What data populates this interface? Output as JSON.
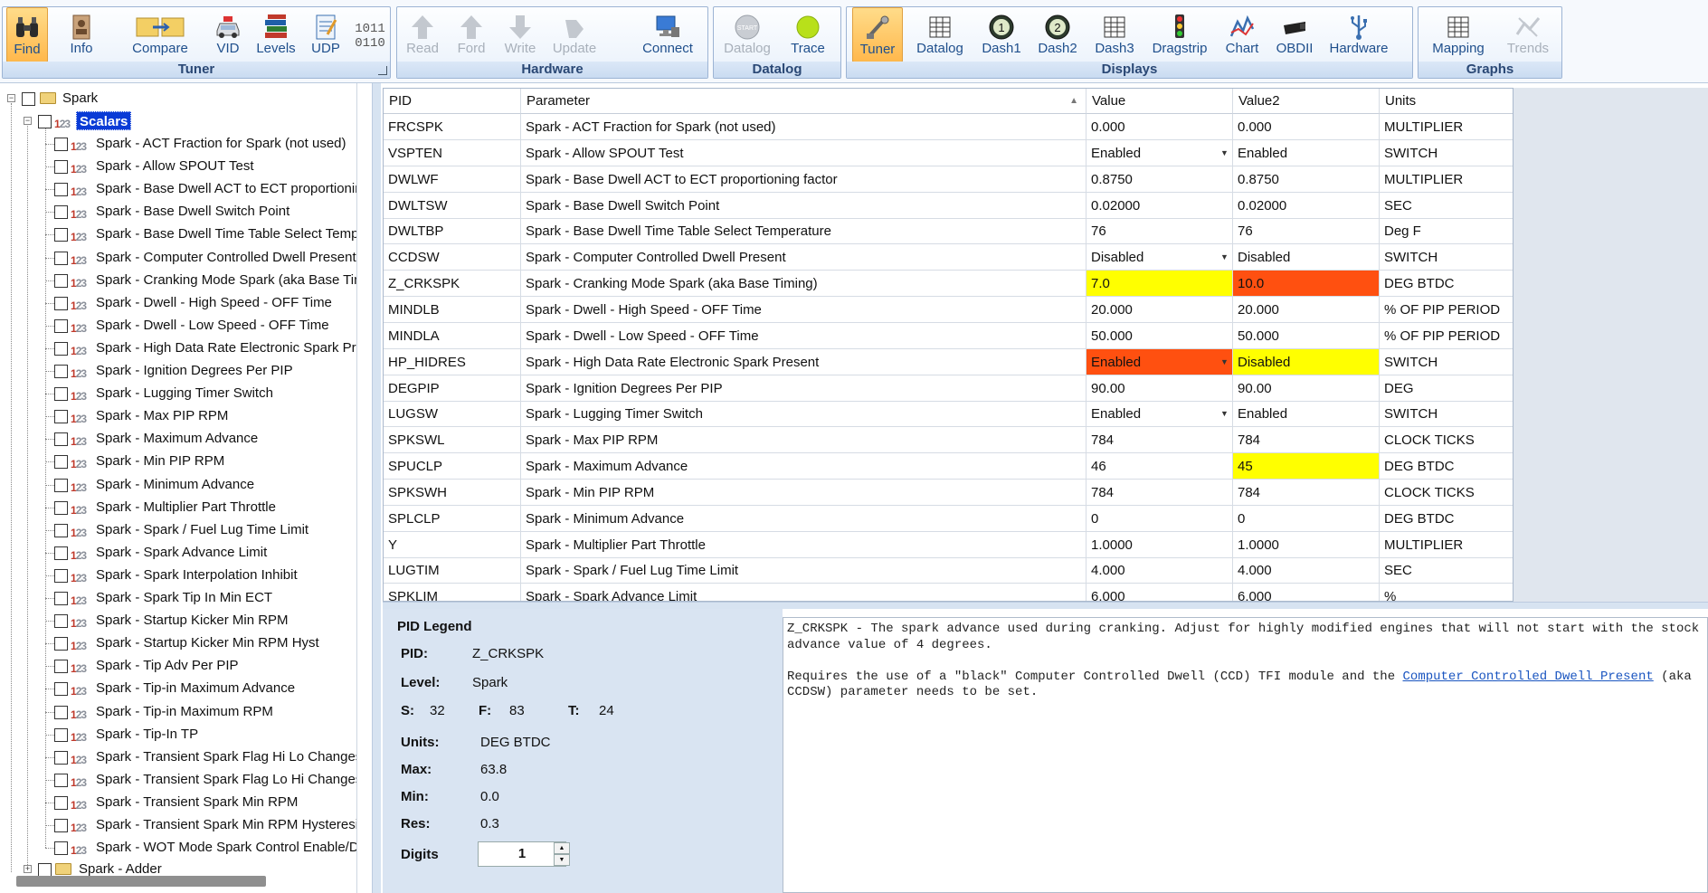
{
  "ribbon": {
    "groups": [
      {
        "title": "Tuner",
        "buttons": [
          {
            "label": "Find",
            "icon": "binoculars-icon",
            "state": "active"
          },
          {
            "label": "Info",
            "icon": "info-card-icon",
            "state": "normal"
          },
          {
            "label": "Compare",
            "icon": "compare-folders-icon",
            "state": "normal"
          },
          {
            "label": "VID",
            "icon": "vehicle-icon",
            "state": "normal"
          },
          {
            "label": "Levels",
            "icon": "books-icon",
            "state": "normal"
          },
          {
            "label": "UDP",
            "icon": "notepad-icon",
            "state": "normal"
          },
          {
            "label": "",
            "icon": "binary-icon",
            "state": "normal"
          }
        ]
      },
      {
        "title": "Hardware",
        "buttons": [
          {
            "label": "Read",
            "icon": "arrow-up-icon",
            "state": "disabled"
          },
          {
            "label": "Ford",
            "icon": "arrow-up-icon",
            "state": "disabled"
          },
          {
            "label": "Write",
            "icon": "arrow-down-icon",
            "state": "disabled"
          },
          {
            "label": "Update",
            "icon": "update-icon",
            "state": "disabled"
          },
          {
            "label": "Connect",
            "icon": "connect-computer-icon",
            "state": "normal"
          }
        ]
      },
      {
        "title": "Datalog",
        "buttons": [
          {
            "label": "Datalog",
            "icon": "start-button-icon",
            "state": "disabled"
          },
          {
            "label": "Trace",
            "icon": "green-dot-icon",
            "state": "normal"
          }
        ]
      },
      {
        "title": "Displays",
        "buttons": [
          {
            "label": "Tuner",
            "icon": "tuner-icon",
            "state": "active"
          },
          {
            "label": "Datalog",
            "icon": "grid-icon",
            "state": "normal"
          },
          {
            "label": "Dash1",
            "icon": "gauge-1-icon",
            "state": "normal"
          },
          {
            "label": "Dash2",
            "icon": "gauge-2-icon",
            "state": "normal"
          },
          {
            "label": "Dash3",
            "icon": "grid-icon",
            "state": "normal"
          },
          {
            "label": "Dragstrip",
            "icon": "traffic-light-icon",
            "state": "normal"
          },
          {
            "label": "Chart",
            "icon": "chart-icon",
            "state": "normal"
          },
          {
            "label": "OBDII",
            "icon": "obd-connector-icon",
            "state": "normal"
          },
          {
            "label": "Hardware",
            "icon": "usb-icon",
            "state": "normal"
          }
        ]
      },
      {
        "title": "Graphs",
        "buttons": [
          {
            "label": "Mapping",
            "icon": "grid-icon",
            "state": "normal"
          },
          {
            "label": "Trends",
            "icon": "trends-icon",
            "state": "disabled"
          }
        ]
      }
    ],
    "binary_icon_text": [
      "1011",
      "0110"
    ]
  },
  "tree": {
    "root": "Spark",
    "scalars": "Scalars",
    "items": [
      "Spark - ACT Fraction for Spark (not used)",
      "Spark - Allow SPOUT Test",
      "Spark - Base Dwell ACT to ECT proportioning",
      "Spark - Base Dwell Switch Point",
      "Spark - Base Dwell Time Table Select Temper",
      "Spark - Computer Controlled Dwell Present",
      "Spark - Cranking Mode Spark (aka Base Tim",
      "Spark - Dwell - High Speed - OFF Time",
      "Spark - Dwell - Low Speed - OFF Time",
      "Spark - High Data Rate Electronic Spark Pres",
      "Spark - Ignition Degrees Per PIP",
      "Spark - Lugging Timer Switch",
      "Spark - Max PIP RPM",
      "Spark - Maximum Advance",
      "Spark - Min PIP RPM",
      "Spark - Minimum Advance",
      "Spark - Multiplier Part Throttle",
      "Spark - Spark / Fuel Lug Time Limit",
      "Spark - Spark Advance Limit",
      "Spark - Spark Interpolation Inhibit",
      "Spark - Spark Tip In Min ECT",
      "Spark - Startup Kicker Min RPM",
      "Spark - Startup Kicker Min RPM Hyst",
      "Spark - Tip Adv Per PIP",
      "Spark - Tip-in Maximum Advance",
      "Spark - Tip-in Maximum RPM",
      "Spark - Tip-In TP",
      "Spark - Transient Spark Flag Hi Lo Changes",
      "Spark - Transient Spark Flag Lo Hi Changes",
      "Spark - Transient Spark Min RPM",
      "Spark - Transient Spark Min RPM Hysteresis",
      "Spark - WOT Mode Spark Control Enable/Di"
    ],
    "next_folder": "Spark - Adder",
    "icon_text": "123"
  },
  "grid": {
    "columns": [
      "PID",
      "Parameter",
      "Value",
      "Value2",
      "Units"
    ],
    "sort_indicator": "▲",
    "rows": [
      {
        "pid": "FRCSPK",
        "param": "Spark - ACT Fraction for Spark (not used)",
        "v1": "0.000",
        "v2": "0.000",
        "units": "MULTIPLIER",
        "dd": false,
        "c1": "",
        "c2": ""
      },
      {
        "pid": "VSPTEN",
        "param": "Spark - Allow SPOUT Test",
        "v1": "Enabled",
        "v2": "Enabled",
        "units": "SWITCH",
        "dd": true,
        "c1": "",
        "c2": ""
      },
      {
        "pid": "DWLWF",
        "param": "Spark - Base Dwell ACT to ECT proportioning factor",
        "v1": "0.8750",
        "v2": "0.8750",
        "units": "MULTIPLIER",
        "dd": false,
        "c1": "",
        "c2": ""
      },
      {
        "pid": "DWLTSW",
        "param": "Spark - Base Dwell Switch Point",
        "v1": "0.02000",
        "v2": "0.02000",
        "units": "SEC",
        "dd": false,
        "c1": "",
        "c2": ""
      },
      {
        "pid": "DWLTBP",
        "param": "Spark - Base Dwell Time Table Select Temperature",
        "v1": "76",
        "v2": "76",
        "units": "Deg F",
        "dd": false,
        "c1": "",
        "c2": ""
      },
      {
        "pid": "CCDSW",
        "param": "Spark - Computer Controlled Dwell Present",
        "v1": "Disabled",
        "v2": "Disabled",
        "units": "SWITCH",
        "dd": true,
        "c1": "",
        "c2": ""
      },
      {
        "pid": "Z_CRKSPK",
        "param": "Spark - Cranking Mode Spark (aka Base Timing)",
        "v1": "7.0",
        "v2": "10.0",
        "units": "DEG BTDC",
        "dd": false,
        "c1": "yellow",
        "c2": "orange"
      },
      {
        "pid": "MINDLB",
        "param": "Spark - Dwell - High Speed - OFF Time",
        "v1": "20.000",
        "v2": "20.000",
        "units": "% OF PIP PERIOD",
        "dd": false,
        "c1": "",
        "c2": ""
      },
      {
        "pid": "MINDLA",
        "param": "Spark - Dwell - Low Speed - OFF Time",
        "v1": "50.000",
        "v2": "50.000",
        "units": "% OF PIP PERIOD",
        "dd": false,
        "c1": "",
        "c2": ""
      },
      {
        "pid": "HP_HIDRES",
        "param": "Spark - High Data Rate Electronic Spark Present",
        "v1": "Enabled",
        "v2": "Disabled",
        "units": "SWITCH",
        "dd": true,
        "c1": "orange",
        "c2": "yellow"
      },
      {
        "pid": "DEGPIP",
        "param": "Spark - Ignition Degrees Per PIP",
        "v1": "90.00",
        "v2": "90.00",
        "units": "DEG",
        "dd": false,
        "c1": "",
        "c2": ""
      },
      {
        "pid": "LUGSW",
        "param": "Spark - Lugging Timer Switch",
        "v1": "Enabled",
        "v2": "Enabled",
        "units": "SWITCH",
        "dd": true,
        "c1": "",
        "c2": ""
      },
      {
        "pid": "SPKSWL",
        "param": "Spark - Max PIP RPM",
        "v1": "784",
        "v2": "784",
        "units": "CLOCK TICKS",
        "dd": false,
        "c1": "",
        "c2": ""
      },
      {
        "pid": "SPUCLP",
        "param": "Spark - Maximum Advance",
        "v1": "46",
        "v2": "45",
        "units": "DEG BTDC",
        "dd": false,
        "c1": "",
        "c2": "yellow"
      },
      {
        "pid": "SPKSWH",
        "param": "Spark - Min PIP RPM",
        "v1": "784",
        "v2": "784",
        "units": "CLOCK TICKS",
        "dd": false,
        "c1": "",
        "c2": ""
      },
      {
        "pid": "SPLCLP",
        "param": "Spark - Minimum Advance",
        "v1": "0",
        "v2": "0",
        "units": "DEG BTDC",
        "dd": false,
        "c1": "",
        "c2": ""
      },
      {
        "pid": "Y",
        "param": "Spark - Multiplier Part Throttle",
        "v1": "1.0000",
        "v2": "1.0000",
        "units": "MULTIPLIER",
        "dd": false,
        "c1": "",
        "c2": ""
      },
      {
        "pid": "LUGTIM",
        "param": "Spark - Spark / Fuel Lug Time Limit",
        "v1": "4.000",
        "v2": "4.000",
        "units": "SEC",
        "dd": false,
        "c1": "",
        "c2": ""
      },
      {
        "pid": "SPKLIM",
        "param": "Spark - Spark Advance Limit",
        "v1": "6.000",
        "v2": "6.000",
        "units": "%",
        "dd": false,
        "c1": "",
        "c2": ""
      }
    ]
  },
  "legend": {
    "title": "PID Legend",
    "pid_label": "PID:",
    "pid_value": "Z_CRKSPK",
    "level_label": "Level:",
    "level_value": "Spark",
    "s_label": "S:",
    "s_value": "32",
    "f_label": "F:",
    "f_value": "83",
    "t_label": "T:",
    "t_value": "24",
    "units_label": "Units:",
    "units_value": "DEG BTDC",
    "max_label": "Max:",
    "max_value": "63.8",
    "min_label": "Min:",
    "min_value": "0.0",
    "res_label": "Res:",
    "res_value": "0.3",
    "digits_label": "Digits",
    "digits_value": "1"
  },
  "description": {
    "line1": "Z_CRKSPK - The spark advance used during cranking. Adjust for highly modified engines that will not start with the stock advance value of 4 degrees.",
    "line2_pre": "Requires the use of a \"black\" Computer Controlled Dwell (CCD) TFI module and the ",
    "line2_link": "Computer Controlled Dwell Present",
    "line2_post": " (aka CCDSW) parameter needs to be set."
  },
  "colors": {
    "highlight_yellow": "#ffff00",
    "highlight_orange": "#ff5010",
    "ribbon_text": "#1f4f8c"
  }
}
